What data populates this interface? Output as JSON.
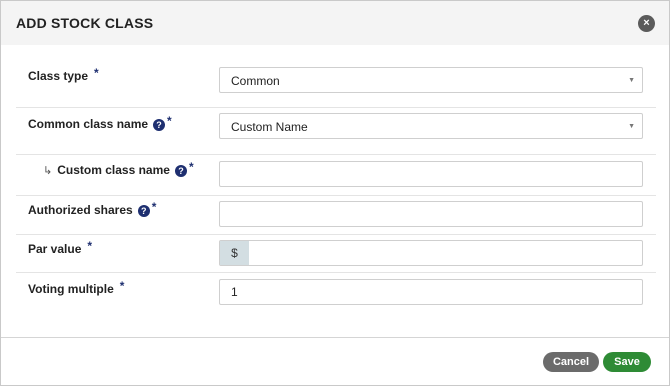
{
  "modal": {
    "title": "ADD STOCK CLASS",
    "close_symbol": "×"
  },
  "form": {
    "class_type": {
      "label": "Class type",
      "required": "*",
      "value": "Common"
    },
    "common_class_name": {
      "label": "Common class name",
      "help": "?",
      "required": "*",
      "value": "Custom Name"
    },
    "custom_class_name": {
      "arrow": "↳",
      "label": "Custom class name",
      "help": "?",
      "required": "*",
      "value": ""
    },
    "authorized_shares": {
      "label": "Authorized shares",
      "help": "?",
      "required": "*",
      "value": ""
    },
    "par_value": {
      "label": "Par value",
      "required": "*",
      "prefix": "$",
      "value": ""
    },
    "voting_multiple": {
      "label": "Voting multiple",
      "required": "*",
      "value": "1"
    }
  },
  "footer": {
    "cancel_label": "Cancel",
    "save_label": "Save"
  },
  "icons": {
    "dropdown_caret": "▼",
    "help": "question-circle-icon",
    "close": "close-icon"
  },
  "colors": {
    "required_asterisk": "#1e2f70",
    "help_icon": "#1e2f70",
    "save_button": "#2e8b35",
    "cancel_button": "#6b6b6b",
    "prefix_background": "#d3dee2"
  }
}
